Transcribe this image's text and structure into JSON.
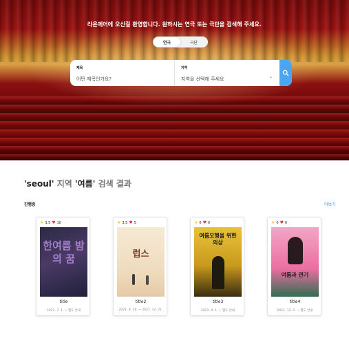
{
  "hero": {
    "title": "라온에어에 오신걸 환영합니다. 원하시는 연극 또는 극단을 검색해 주세요.",
    "toggle": [
      {
        "label": "연극"
      },
      {
        "label": "극단"
      }
    ],
    "search": {
      "title_label": "제목",
      "title_placeholder": "어떤 제목인가요?",
      "region_label": "지역",
      "region_placeholder": "지역을 선택해 주세요",
      "search_icon": "search-icon"
    }
  },
  "results": {
    "title_region": "'seoul'",
    "title_region_word": " 지역 ",
    "title_keyword": "'여름'",
    "title_suffix": " 검색 결과",
    "section_label": "진행중",
    "more_label": "더보기"
  },
  "cards": [
    {
      "rating": "3.5",
      "likes": "10",
      "title": "title",
      "date": "2021. 7. 1. ~ 별도 안내",
      "poster_text": "한여름 밤의 꿈"
    },
    {
      "rating": "3.5",
      "likes": "5",
      "title": "title2",
      "date": "2021. 8. 26. ~ 2021. 12. 21.",
      "poster_text": "럽스"
    },
    {
      "rating": "0",
      "likes": "0",
      "title": "title3",
      "date": "2021. 9. 1. ~ 별도 안내",
      "poster_text": "여름오행을 위한의상"
    },
    {
      "rating": "0",
      "likes": "0",
      "title": "title4",
      "date": "2021. 12. 1. ~ 별도 안내",
      "poster_text": "여름과 연기"
    }
  ],
  "colors": {
    "accent": "#47a7f5",
    "star": "#f5c518",
    "heart": "#e2364a",
    "more_link": "#4a90e2"
  }
}
